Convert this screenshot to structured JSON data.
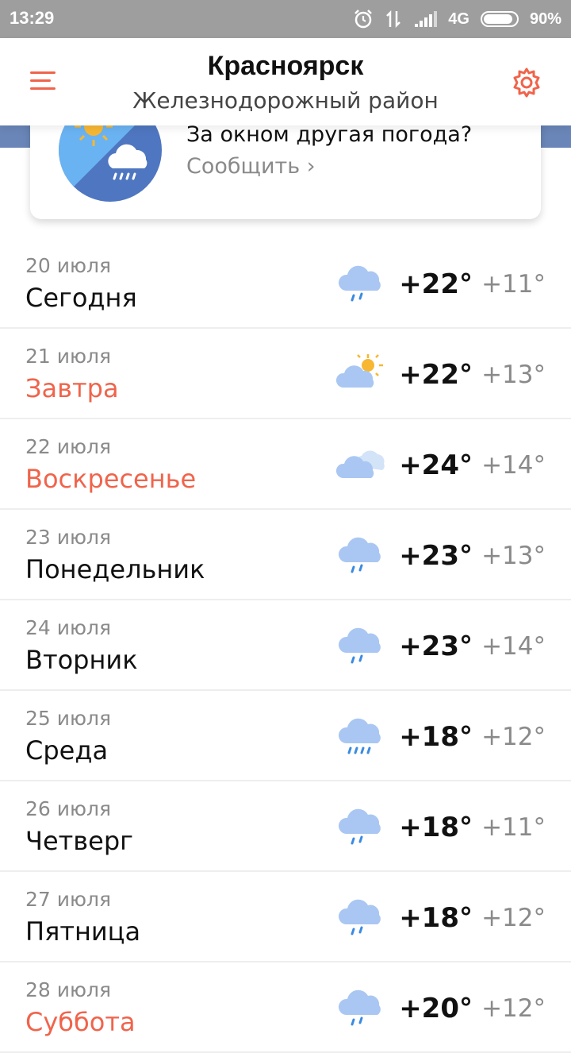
{
  "status_bar": {
    "time": "13:29",
    "network": "4G",
    "battery": "90%",
    "battery_level": 0.9
  },
  "header": {
    "city": "Красноярск",
    "district": "Железнодорожный район"
  },
  "report": {
    "title": "За окном другая погода?",
    "link": "Сообщить ›"
  },
  "colors": {
    "accent": "#f0644b",
    "status_bar": "#9e9e9e",
    "rain_icon": "#a9c7f2"
  },
  "forecast": [
    {
      "date": "20 июля",
      "day": "Сегодня",
      "tmax": "+22°",
      "tmin": "+11°",
      "icon": "rain-icon",
      "weekend": false
    },
    {
      "date": "21 июля",
      "day": "Завтра",
      "tmax": "+22°",
      "tmin": "+13°",
      "icon": "sun-cloud-icon",
      "weekend": true
    },
    {
      "date": "22 июля",
      "day": "Воскресенье",
      "tmax": "+24°",
      "tmin": "+14°",
      "icon": "cloudy-icon",
      "weekend": true
    },
    {
      "date": "23 июля",
      "day": "Понедельник",
      "tmax": "+23°",
      "tmin": "+13°",
      "icon": "rain-icon",
      "weekend": false
    },
    {
      "date": "24 июля",
      "day": "Вторник",
      "tmax": "+23°",
      "tmin": "+14°",
      "icon": "rain-icon",
      "weekend": false
    },
    {
      "date": "25 июля",
      "day": "Среда",
      "tmax": "+18°",
      "tmin": "+12°",
      "icon": "heavy-rain-icon",
      "weekend": false
    },
    {
      "date": "26 июля",
      "day": "Четверг",
      "tmax": "+18°",
      "tmin": "+11°",
      "icon": "rain-icon",
      "weekend": false
    },
    {
      "date": "27 июля",
      "day": "Пятница",
      "tmax": "+18°",
      "tmin": "+12°",
      "icon": "rain-icon",
      "weekend": false
    },
    {
      "date": "28 июля",
      "day": "Суббота",
      "tmax": "+20°",
      "tmin": "+12°",
      "icon": "rain-icon",
      "weekend": true
    }
  ]
}
